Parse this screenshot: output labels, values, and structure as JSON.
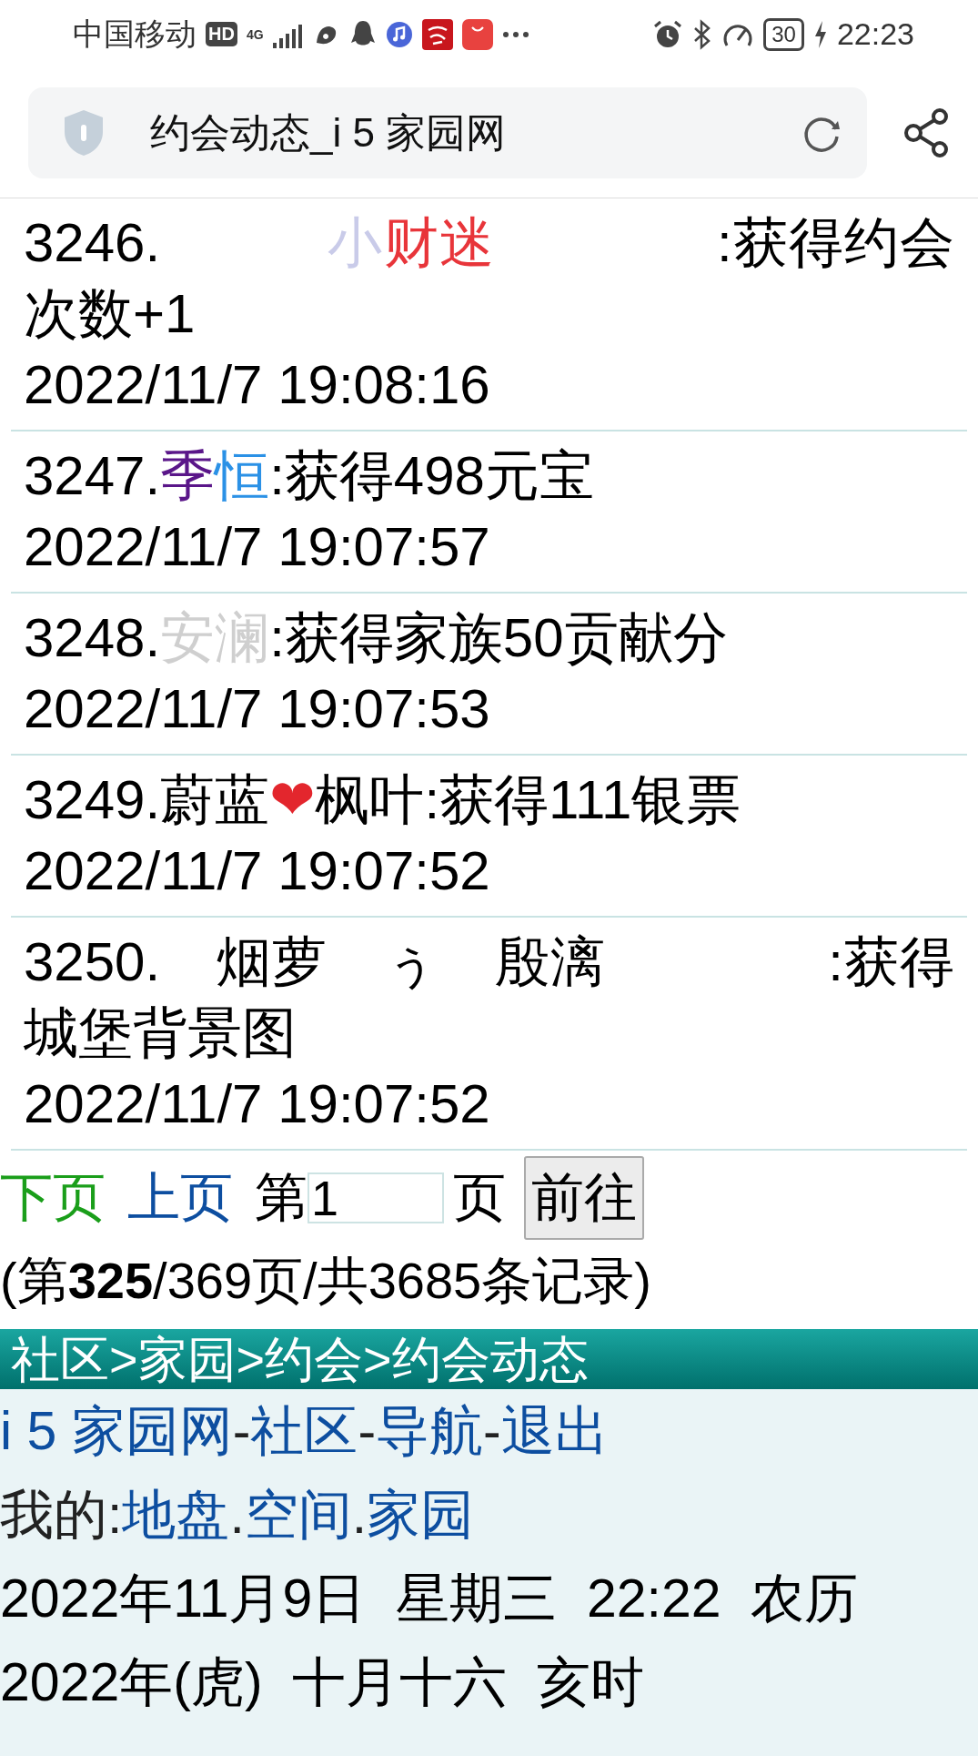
{
  "status_bar": {
    "carrier": "中国移动",
    "hd_badge": "HD",
    "network": "4G",
    "battery": "30",
    "time": "22:23"
  },
  "address_bar": {
    "title": "约会动态_i 5 家园网"
  },
  "entries": [
    {
      "number": "3246.",
      "name_parts": [
        {
          "text": "　　　小",
          "color": "#c9cbe9"
        },
        {
          "text": "财迷　　　　",
          "color": "#e8353a"
        }
      ],
      "action": ":获得约会次数+1",
      "time": "2022/11/7 19:08:16"
    },
    {
      "number": "3247.",
      "name_parts": [
        {
          "text": "季",
          "color": "#5a1689"
        },
        {
          "text": "恒",
          "color": "#2b91e6"
        }
      ],
      "action": ":获得498元宝",
      "time": "2022/11/7 19:07:57"
    },
    {
      "number": "3248.",
      "name_parts": [
        {
          "text": "安澜",
          "color": "#cfcfcf"
        }
      ],
      "action": ":获得家族50贡献分",
      "time": "2022/11/7 19:07:53"
    },
    {
      "number": "3249.",
      "name_parts": [
        {
          "text": "蔚蓝",
          "color": "#000000"
        },
        {
          "text": "❤",
          "color": "#e3262d"
        },
        {
          "text": "枫叶",
          "color": "#000000"
        }
      ],
      "action": ":获得111银票",
      "time": "2022/11/7 19:07:52"
    },
    {
      "number": "3250.",
      "name_parts": [
        {
          "text": "　烟萝　ぅ　殷漓　　　　",
          "color": "#000000"
        }
      ],
      "action": ":获得城堡背景图",
      "time": "2022/11/7 19:07:52"
    }
  ],
  "pager": {
    "next": "下页",
    "prev": "上页",
    "before_field": "第",
    "page_value": "1",
    "after_field": "页",
    "go": "前往",
    "summary": "(第**325**/369页/共3685条记录)"
  },
  "breadcrumb": "社区>家园>约会>约会动态",
  "footer": {
    "nav": [
      {
        "kind": "link",
        "text": "i 5 家园网",
        "separator": "-"
      },
      {
        "kind": "link",
        "text": "社区",
        "separator": "-"
      },
      {
        "kind": "link",
        "text": "导航",
        "separator": "-"
      },
      {
        "kind": "link",
        "text": "退出"
      }
    ],
    "mine": [
      {
        "kind": "text",
        "text": "我的:"
      },
      {
        "kind": "link",
        "text": "地盘",
        "separator": "."
      },
      {
        "kind": "link",
        "text": "空间",
        "separator": "."
      },
      {
        "kind": "link",
        "text": "家园"
      }
    ],
    "date": "2022年11月9日  星期三  22:22  农历  2022年(虎)  十月十六  亥时"
  }
}
